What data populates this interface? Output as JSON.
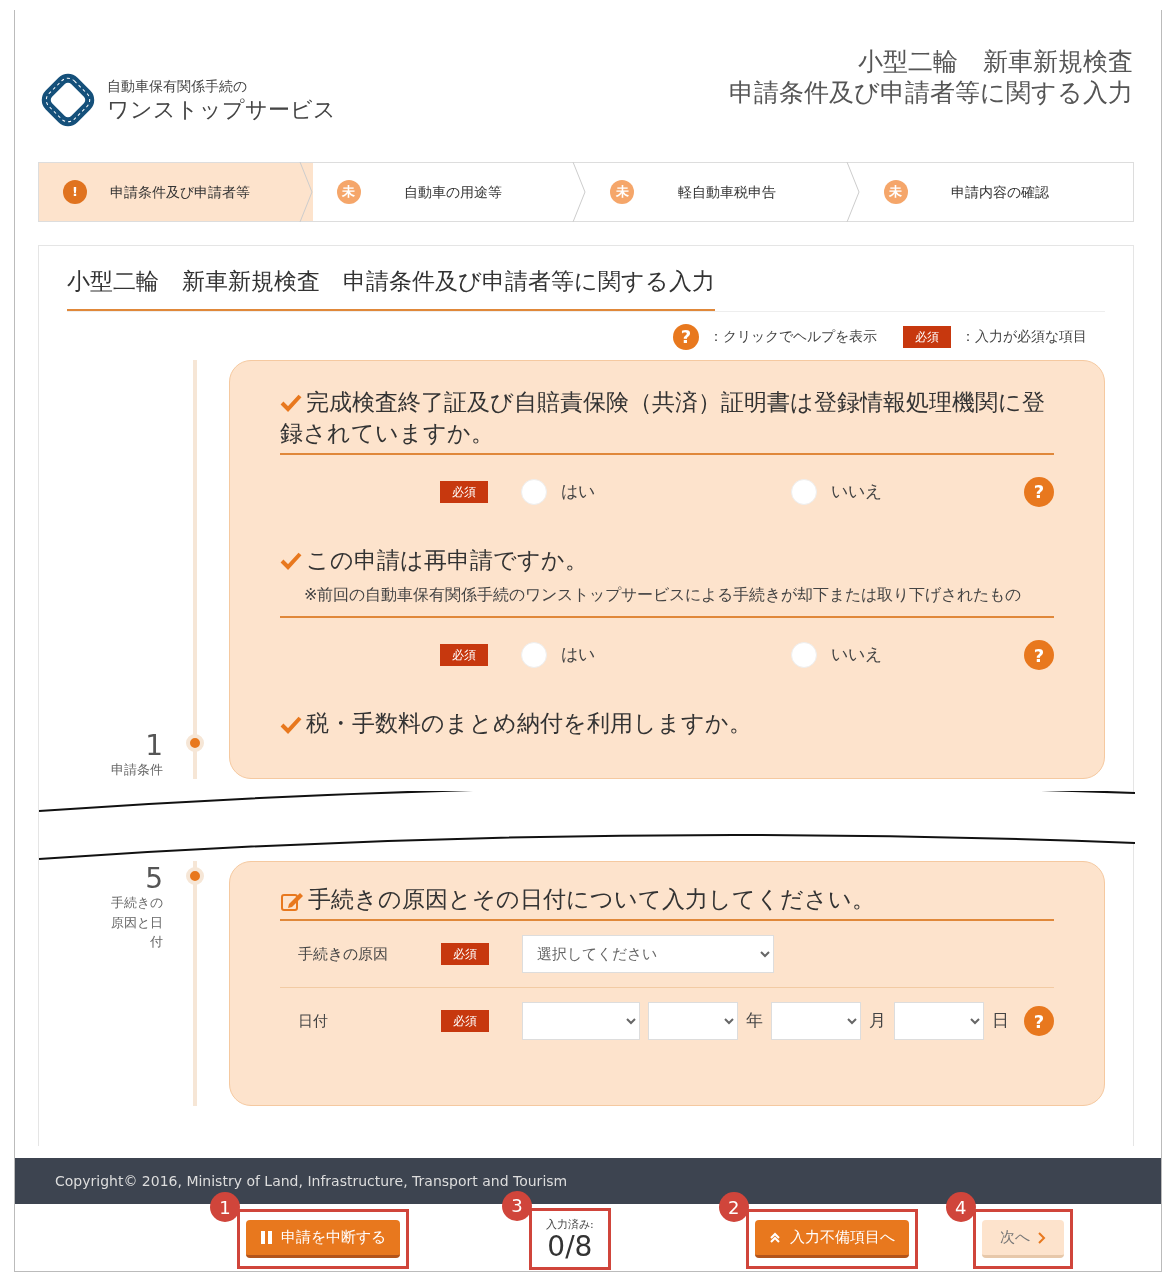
{
  "header": {
    "logo_caption": "自動車保有関係手続の",
    "logo_title": "ワンストップサービス",
    "title_lines": [
      "小型二輪　新車新規検査",
      "申請条件及び申請者等に関する入力"
    ]
  },
  "steps": [
    {
      "label": "申請条件及び申請者等",
      "selected": true,
      "status": "!"
    },
    {
      "label": "自動車の用途等",
      "selected": false,
      "status": "未"
    },
    {
      "label": "軽自動車税申告",
      "selected": false,
      "status": "未"
    },
    {
      "label": "申請内容の確認",
      "selected": false,
      "status": "未"
    }
  ],
  "section_title": "小型二輪　新車新規検査　申請条件及び申請者等に関する入力",
  "legend": {
    "help_icon": "?",
    "help_text": "：クリックでヘルプを表示",
    "required_badge": "必須",
    "required_text": "：入力が必須な項目"
  },
  "section_1": {
    "number": "1",
    "label": "申請条件",
    "questions": [
      {
        "title": "完成検査終了証及び自賠責保険（共済）証明書は登録情報処理機関に登録されていますか。",
        "required": "必須",
        "help": "?",
        "options": [
          {
            "label": "はい",
            "selected": false
          },
          {
            "label": "いいえ",
            "selected": false
          }
        ]
      },
      {
        "title": "この申請は再申請ですか。",
        "note": "※前回の自動車保有関係手続のワンストップサービスによる手続きが却下または取り下げされたもの",
        "required": "必須",
        "help": "?",
        "options": [
          {
            "label": "はい",
            "selected": false
          },
          {
            "label": "いいえ",
            "selected": false
          }
        ]
      },
      {
        "title": "税・手数料のまとめ納付を利用しますか。"
      }
    ]
  },
  "section_5": {
    "number": "5",
    "label": "手続きの原因と日付",
    "title": "手続きの原因とその日付について入力してください。",
    "fields": [
      {
        "label": "手続きの原因",
        "required": "必須",
        "parts": [
          {
            "kind": "select",
            "value": "選択してください"
          }
        ]
      },
      {
        "label": "日付",
        "required": "必須",
        "help": "?",
        "parts": [
          {
            "kind": "select"
          },
          {
            "kind": "select"
          },
          {
            "kind": "unit",
            "text": "年"
          },
          {
            "kind": "select"
          },
          {
            "kind": "unit",
            "text": "月"
          },
          {
            "kind": "select"
          },
          {
            "kind": "unit",
            "text": "日"
          }
        ]
      }
    ]
  },
  "footer": {
    "copyright": "Copyright© 2016, Ministry of Land, Infrastructure, Transport and Tourism"
  },
  "actions": [
    {
      "kind": "button",
      "label": "申請を中断する",
      "marker": "1",
      "disabled": false
    },
    {
      "kind": "progress",
      "caption": "入力済み:",
      "value": "0/8",
      "marker": "3"
    },
    {
      "kind": "button",
      "label": "入力不備項目へ",
      "marker": "2",
      "disabled": false
    },
    {
      "kind": "button",
      "label": "次へ",
      "marker": "4",
      "disabled": true
    }
  ]
}
